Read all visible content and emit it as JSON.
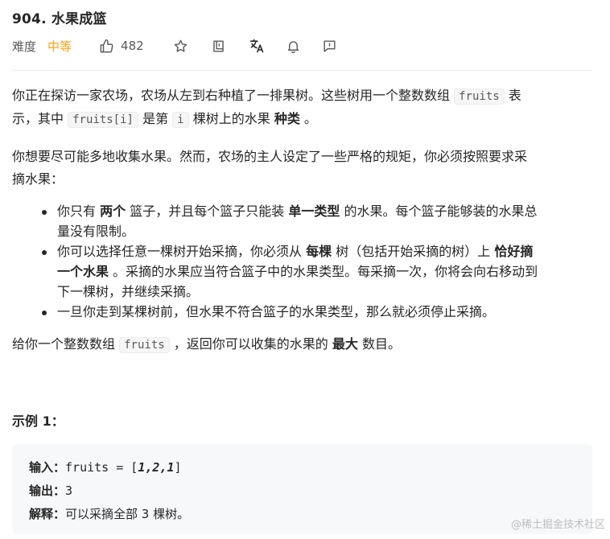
{
  "problem": {
    "title": "904. 水果成篮",
    "difficulty_label": "难度",
    "difficulty": "中等",
    "likes": "482"
  },
  "description": {
    "p1_a": "你正在探访一家农场，农场从左到右种植了一排果树。这些树用一个整数数组",
    "p1_code1": "fruits",
    "p1_b": "表",
    "p1_c": "示，其中",
    "p1_code2": "fruits[i]",
    "p1_d": "是第",
    "p1_code3": "i",
    "p1_e": "棵树上的水果",
    "p1_bold": "种类",
    "p1_f": "。",
    "p2": "你想要尽可能多地收集水果。然而，农场的主人设定了一些严格的规矩，你必须按照要求采",
    "p2b": "摘水果：",
    "rule1_a": "你只有",
    "rule1_b1": "两个",
    "rule1_c": "篮子，并且每个篮子只能装",
    "rule1_b2": "单一类型",
    "rule1_d": "的水果。每个篮子能够装的水果总",
    "rule1_e": "量没有限制。",
    "rule2_a": "你可以选择任意一棵树开始采摘，你必须从",
    "rule2_b1": "每棵",
    "rule2_c": "树（包括开始采摘的树）上",
    "rule2_b2a": "恰好摘",
    "rule2_b2b": "一个水果",
    "rule2_d": "。采摘的水果应当符合篮子中的水果类型。每采摘一次，你将会向右移动到",
    "rule2_e": "下一棵树，并继续采摘。",
    "rule3": "一旦你走到某棵树前，但水果不符合篮子的水果类型，那么就必须停止采摘。",
    "p3_a": "给你一个整数数组",
    "p3_code": "fruits",
    "p3_b": "，返回你可以收集的水果的",
    "p3_bold": "最大",
    "p3_c": "数目。"
  },
  "example": {
    "title": "示例 1：",
    "input_label": "输入：",
    "input_prefix": "fruits = [",
    "input_values": "1,2,1",
    "input_suffix": "]",
    "output_label": "输出：",
    "output_value": "3",
    "explain_label": "解释：",
    "explain_value": "可以采摘全部 3 棵树。"
  },
  "watermark": "@稀土掘金技术社区",
  "colors": {
    "accent": "#ffa116",
    "text": "#262626",
    "muted": "#595959"
  }
}
